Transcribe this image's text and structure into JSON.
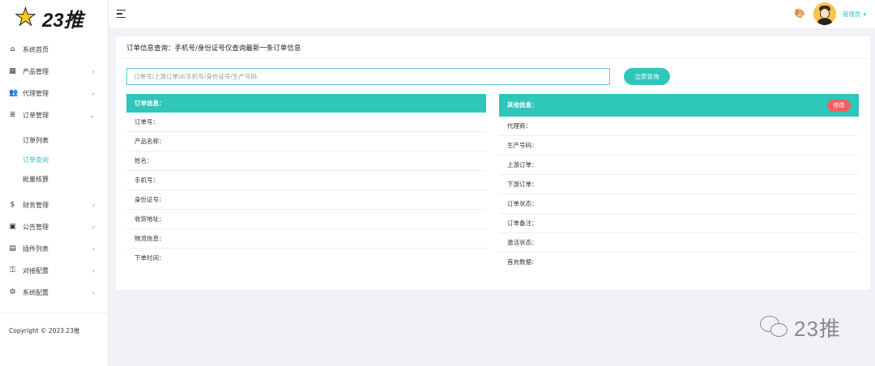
{
  "brand": {
    "logo_text": "23推",
    "accent": "#2ec7b9",
    "logo_color": "#ffc81e"
  },
  "sidebar": {
    "items": [
      {
        "label": "系统首页",
        "icon": "home-icon",
        "has_children": false
      },
      {
        "label": "产品管理",
        "icon": "grid-icon",
        "has_children": true
      },
      {
        "label": "代理管理",
        "icon": "users-icon",
        "has_children": true
      },
      {
        "label": "订单管理",
        "icon": "list-icon",
        "has_children": true,
        "expanded": true
      }
    ],
    "submenu": [
      {
        "label": "订单列表",
        "active": false
      },
      {
        "label": "订单查询",
        "active": true
      },
      {
        "label": "批量核算",
        "active": false
      }
    ],
    "items_after": [
      {
        "label": "财务管理",
        "icon": "finance-icon",
        "has_children": true
      },
      {
        "label": "公告管理",
        "icon": "announcement-icon",
        "has_children": true
      },
      {
        "label": "插件列表",
        "icon": "plugin-icon",
        "has_children": true
      },
      {
        "label": "对接配置",
        "icon": "key-icon",
        "has_children": true
      },
      {
        "label": "系统配置",
        "icon": "settings-user-icon",
        "has_children": true
      }
    ],
    "copyright": "Copyright © 2023.23推"
  },
  "topbar": {
    "user_name": "管理员",
    "palette_icon": "palette-icon"
  },
  "main": {
    "title": "订单信息查询：手机号/身份证号仅查询最新一条订单信息",
    "search": {
      "placeholder": "订单号/上游订单id/手机号/身份证号/生产号码",
      "button_label": "立即查询"
    },
    "order_panel": {
      "title": "订单信息：",
      "fields": [
        "订单号：",
        "产品名称：",
        "姓名：",
        "手机号：",
        "身份证号：",
        "收货地址：",
        "物流信息：",
        "下单时间："
      ]
    },
    "other_panel": {
      "title": "其他信息：",
      "edit_label": "修改",
      "edit_color": "#f0615f",
      "fields": [
        "代理商：",
        "生产号码：",
        "上游订单：",
        "下游订单：",
        "订单状态：",
        "订单备注：",
        "激活状态：",
        "首充数据："
      ]
    }
  },
  "watermark": {
    "text": "23推",
    "icon": "wechat-icon"
  }
}
